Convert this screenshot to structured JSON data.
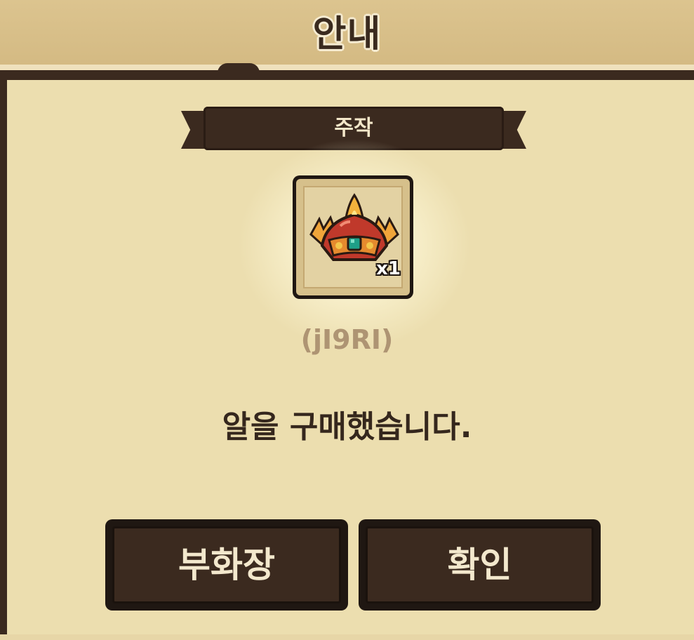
{
  "dialog": {
    "title": "안내",
    "category": "주작",
    "item": {
      "name": "(jI9RI)",
      "quantity": "x1",
      "icon": "phoenix-crown-icon"
    },
    "message": "알을 구매했습니다.",
    "buttons": {
      "left": "부화장",
      "right": "확인"
    }
  },
  "colors": {
    "panel": "#ecdeaf",
    "header": "#d4ba83",
    "dark_brown": "#3b2a1f",
    "text_dark": "#35271d",
    "item_name": "#ae9473"
  }
}
